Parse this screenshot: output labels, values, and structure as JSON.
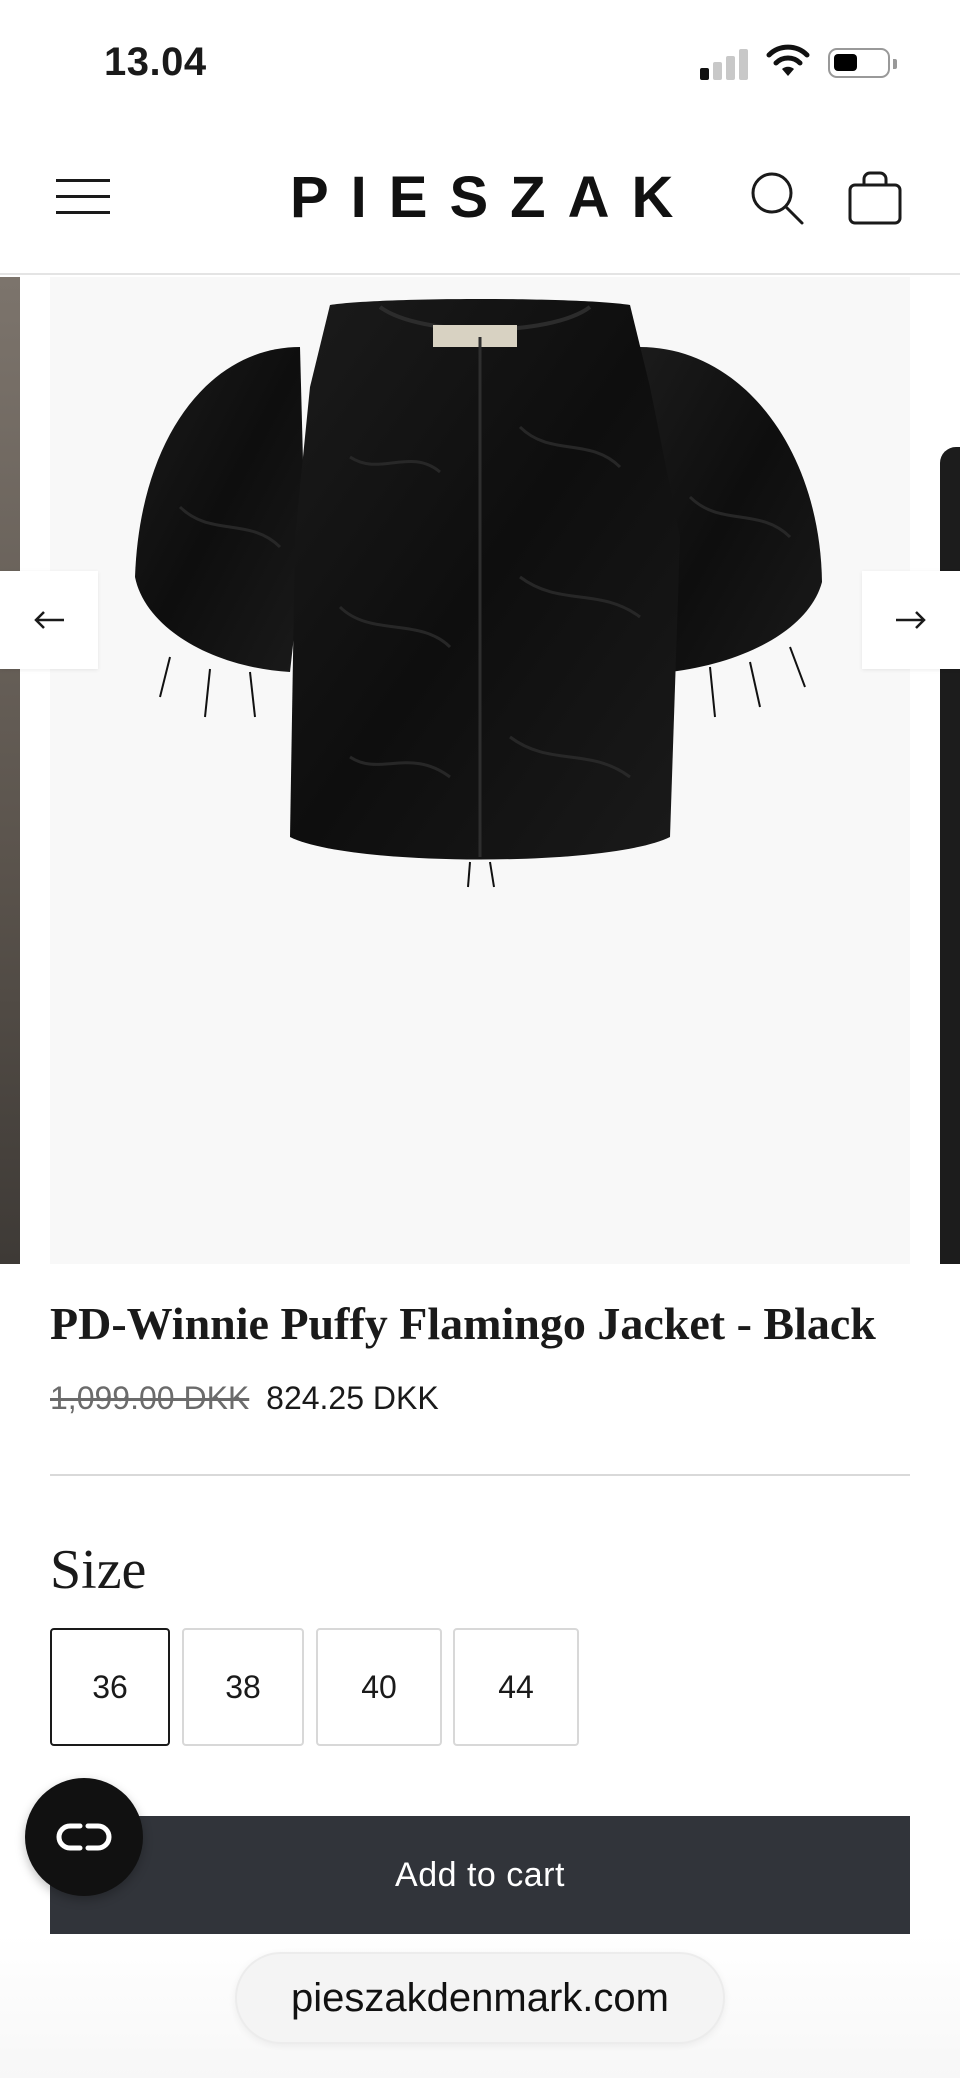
{
  "status_bar": {
    "time": "13.04",
    "signal_bars_active": 1,
    "signal_bars_total": 4,
    "battery_level_fraction": 0.45
  },
  "header": {
    "logo": "PIESZAK",
    "menu_icon": "hamburger-menu-icon",
    "search_icon": "search-icon",
    "cart_icon": "shopping-bag-icon"
  },
  "gallery": {
    "image_description_icon": "product-image",
    "prev_icon": "arrow-left-icon",
    "next_icon": "arrow-right-icon"
  },
  "product": {
    "title": "PD-Winnie Puffy Flamingo Jacket - Black",
    "price_original": "1,099.00 DKK",
    "price_sale": "824.25 DKK"
  },
  "size_selector": {
    "label": "Size",
    "options": [
      "36",
      "38",
      "40",
      "44"
    ],
    "selected": "36"
  },
  "actions": {
    "add_to_cart_label": "Add to cart",
    "chat_icon": "chat-link-icon"
  },
  "browser": {
    "url": "pieszakdenmark.com"
  },
  "colors": {
    "button_dark": "#31343a",
    "text": "#1a1a1a",
    "image_bg": "#f8f8f8"
  }
}
